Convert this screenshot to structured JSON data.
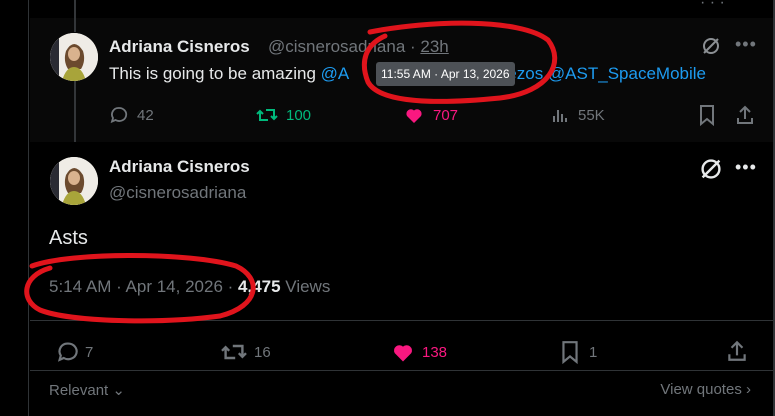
{
  "reply": {
    "name": "Adriana Cisneros",
    "handle_and_time_prefix": "@cisnerosadriana · ",
    "time": "23h",
    "text_before": "This is going to be amazing ",
    "mention_start": "@A",
    "mention_end": "ezos",
    "mention_last": " @AST_SpaceMobile",
    "tooltip": "11:55 AM · Apr 13, 2026",
    "actions": {
      "replies": "42",
      "reposts": "100",
      "likes": "707",
      "views": "55K"
    }
  },
  "main": {
    "name": "Adriana Cisneros",
    "handle": "@cisnerosadriana",
    "text": "Asts",
    "timestamp": "5:14 AM · Apr 14, 2026 · ",
    "views_count": "4,475",
    "views_label": " Views",
    "actions": {
      "replies": "7",
      "reposts": "16",
      "likes": "138",
      "bookmarks": "1"
    }
  },
  "footer": {
    "sort_label": "Relevant",
    "view_quotes": "View quotes"
  },
  "colors": {
    "accent": "#1d9bf0",
    "repost_active": "#00ba7c",
    "like_active": "#f91880",
    "annotation": "#e0141c"
  },
  "icons": [
    "reply-icon",
    "repost-icon",
    "heart-icon",
    "views-icon",
    "bookmark-icon",
    "share-icon",
    "grok-icon",
    "more-icon",
    "chevron-down-icon",
    "chevron-right-icon"
  ]
}
